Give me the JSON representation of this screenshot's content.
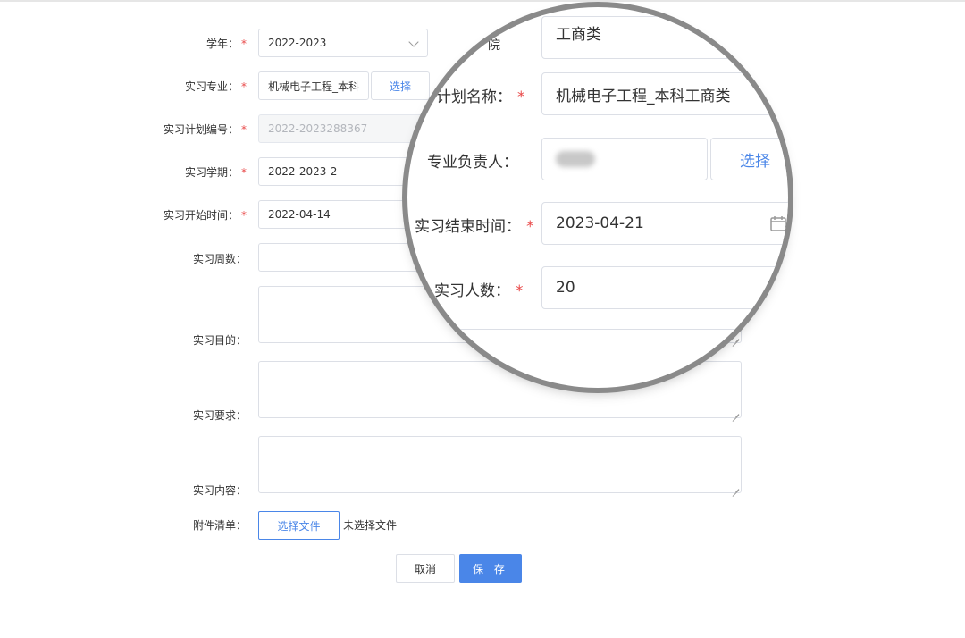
{
  "form": {
    "school_year": {
      "label": "学年：",
      "value": "2022-2023"
    },
    "major": {
      "label": "实习专业：",
      "value": "机械电子工程_本科",
      "select_label": "选择"
    },
    "plan_no": {
      "label": "实习计划编号：",
      "value": "2022-2023288367"
    },
    "semester": {
      "label": "实习学期：",
      "value": "2022-2023-2"
    },
    "start_time": {
      "label": "实习开始时间：",
      "value": "2022-04-14"
    },
    "weeks": {
      "label": "实习周数：",
      "value": ""
    },
    "purpose": {
      "label": "实习目的："
    },
    "requirement": {
      "label": "实习要求："
    },
    "content": {
      "label": "实习内容："
    },
    "attachment": {
      "label": "附件清单：",
      "button": "选择文件",
      "status": "未选择文件"
    },
    "required_mark": "*",
    "cancel": "取消",
    "save": "保 存"
  },
  "magnifier": {
    "category": {
      "label_fragment": "院",
      "value": "工商类"
    },
    "plan_name": {
      "label": "计划名称：",
      "value": "机械电子工程_本科工商类"
    },
    "leader": {
      "label": "专业负责人：",
      "select_label": "选择"
    },
    "end_time": {
      "label": "实习结束时间：",
      "value": "2023-04-21"
    },
    "count": {
      "label": "实习人数：",
      "value": "20"
    },
    "required_mark": "*"
  }
}
